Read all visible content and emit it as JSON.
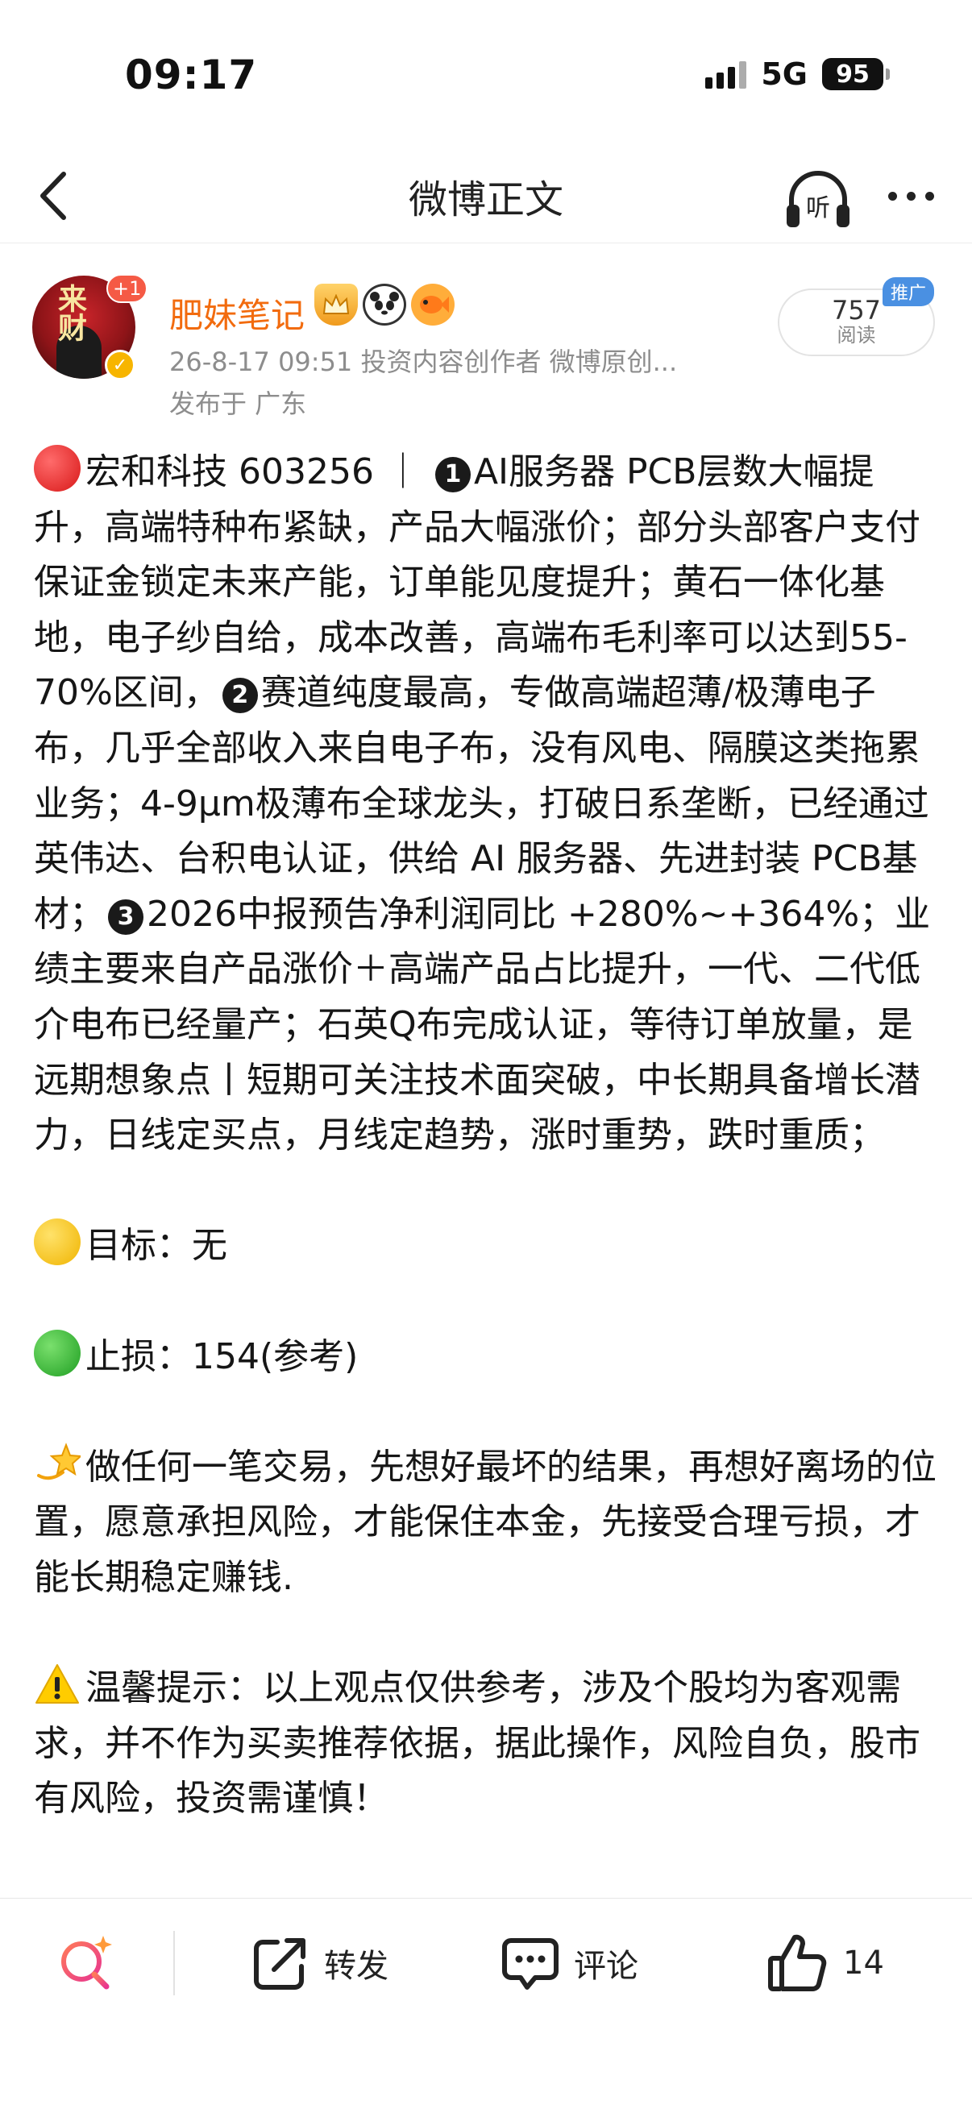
{
  "status_bar": {
    "time": "09:17",
    "network": "5G",
    "battery": "95"
  },
  "nav": {
    "title": "微博正文",
    "listen_label": "听"
  },
  "author": {
    "avatar_text": "来财",
    "avatar_badge": "+1",
    "name": "肥妹笔记",
    "meta": "26-8-17 09:51  投资内容创作者 微博原创...",
    "location": "发布于 广东",
    "reads_count": "757",
    "reads_label": "阅读",
    "promo_label": "推广"
  },
  "post": {
    "line1": "宏和科技 603256 ｜ ",
    "n1": "1",
    "seg1": "AI服务器 PCB层数大幅提升，高端特种布紧缺，产品大幅涨价；部分头部客户支付保证金锁定未来产能，订单能见度提升；黄石一体化基地，电子纱自给，成本改善，高端布毛利率可以达到55-70%区间，",
    "n2": "2",
    "seg2": "赛道纯度最高，专做高端超薄/极薄电子布，几乎全部收入来自电子布，没有风电、隔膜这类拖累业务；4-9μm极薄布全球龙头，打破日系垄断，已经通过英伟达、台积电认证，供给 AI 服务器、先进封装 PCB基材；",
    "n3": "3",
    "seg3": "2026中报预告净利润同比 +280%~+364%；业绩主要来自产品涨价＋高端产品占比提升，一代、二代低介电布已经量产；石英Q布完成认证，等待订单放量，是远期想象点丨短期可关注技术面突破，中长期具备增长潜力，日线定买点，月线定趋势，涨时重势，跌时重质；",
    "target": "目标：无",
    "stoploss": "止损：154(参考)",
    "advice": "做任何一笔交易，先想好最坏的结果，再想好离场的位置，愿意承担风险，才能保住本金，先接受合理亏损，才能长期稳定赚钱.",
    "warning": "温馨提示：以上观点仅供参考，涉及个股均为客观需求，并不作为买卖推荐依据，据此操作，风险自负，股市有风险，投资需谨慎！"
  },
  "actions": {
    "repost": "转发",
    "comment": "评论",
    "like_count": "14"
  },
  "colors": {
    "author_name": "#f26b0e",
    "meta": "#8d8d8d",
    "promo": "#4a90e2"
  }
}
